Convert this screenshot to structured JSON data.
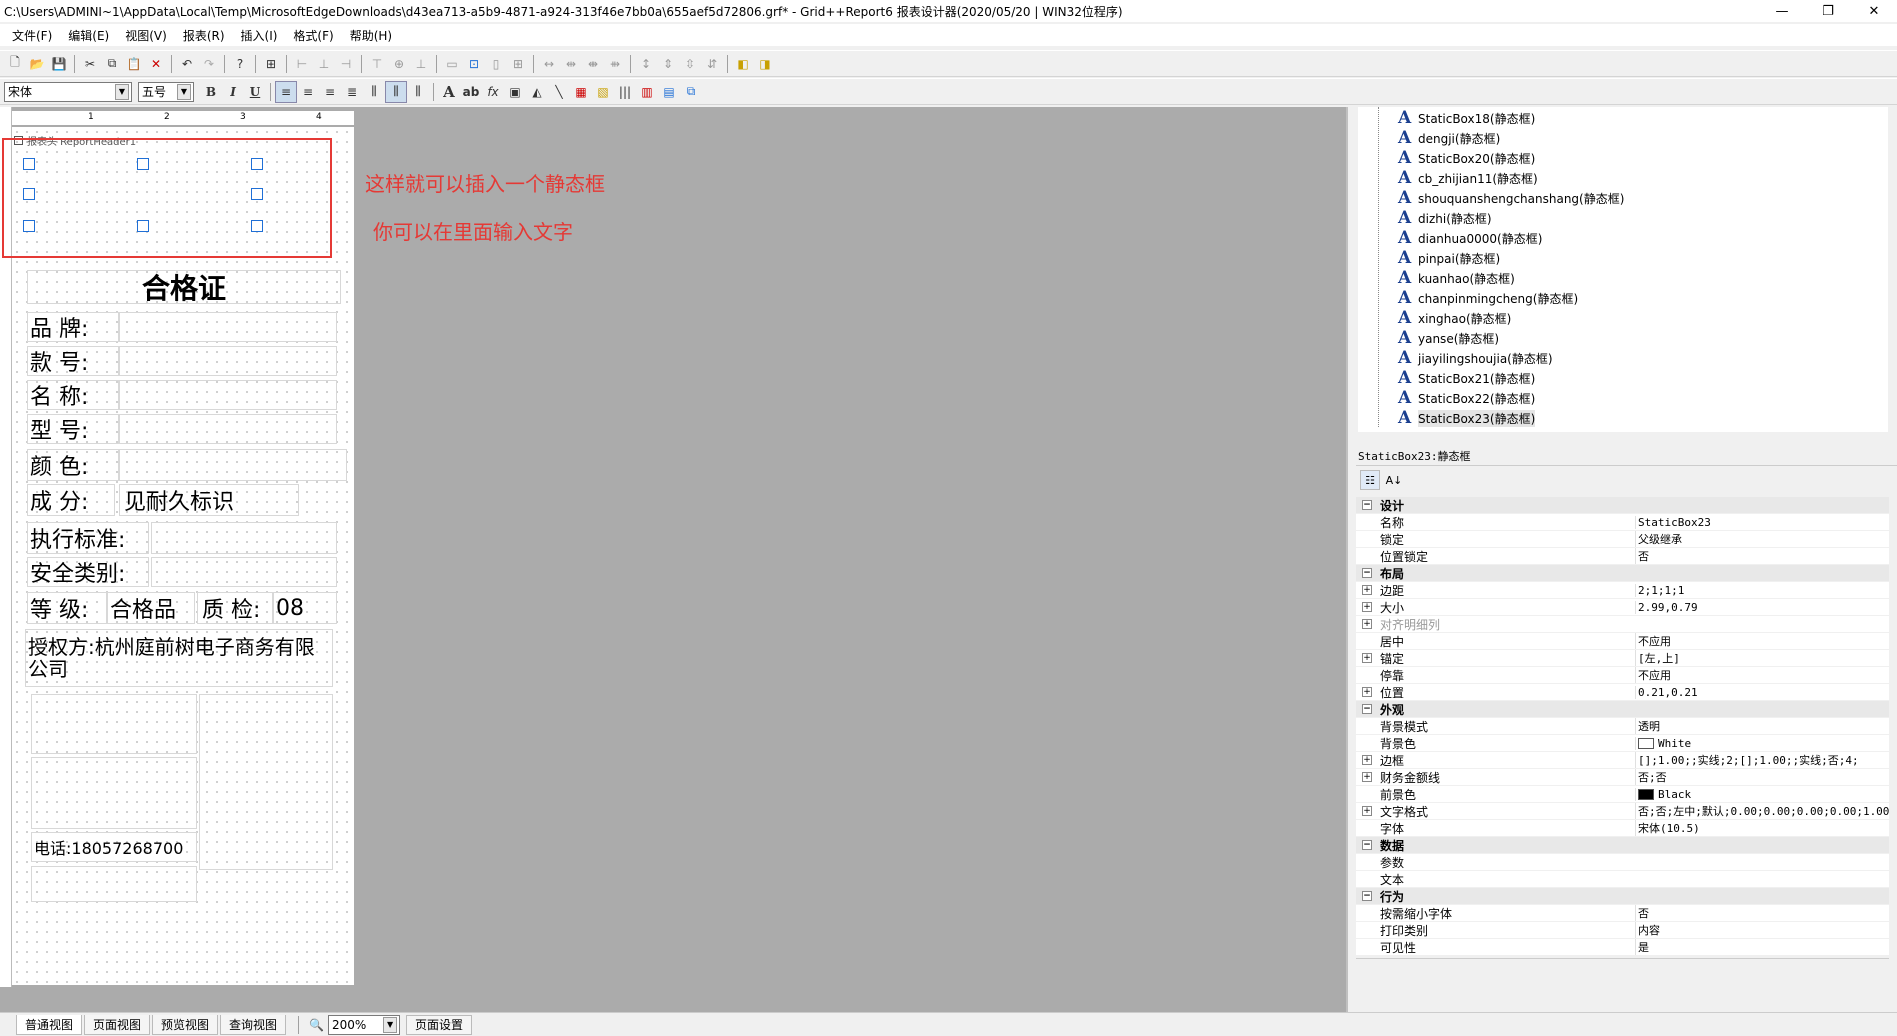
{
  "window": {
    "title": "C:\\Users\\ADMINI~1\\AppData\\Local\\Temp\\MicrosoftEdgeDownloads\\d43ea713-a5b9-4871-a924-313f46e7bb0a\\655aef5d72806.grf* - Grid++Report6 报表设计器(2020/05/20 | WIN32位程序)",
    "minimize": "—",
    "restore": "❐",
    "close": "✕"
  },
  "menu": [
    "文件(F)",
    "编辑(E)",
    "视图(V)",
    "报表(R)",
    "插入(I)",
    "格式(F)",
    "帮助(H)"
  ],
  "format_toolbar": {
    "font_name": "宋体",
    "font_size": "五号",
    "bold": "B",
    "italic": "I",
    "underline": "U"
  },
  "designer": {
    "section_label": "报表头 ReportHeader1",
    "ruler_marks": [
      "1",
      "2",
      "3",
      "4"
    ],
    "annotation_line1": "这样就可以插入一个静态框",
    "annotation_line2": "你可以在里面输入文字",
    "title": "合格证",
    "fields": {
      "brand": "品  牌:",
      "style_no": "款  号:",
      "name": "名  称:",
      "model": "型  号:",
      "color": "颜  色:",
      "composition": "成  分:",
      "composition_value": "见耐久标识",
      "standard": "执行标准:",
      "safety": "安全类别:",
      "grade": "等  级:",
      "grade_value": "合格品",
      "qc": "质  检:",
      "qc_value": "08",
      "authorizer": "授权方:杭州庭前树电子商务有限公司",
      "phone": "电话:18057268700"
    }
  },
  "tree": {
    "items": [
      "StaticBox18(静态框)",
      "dengji(静态框)",
      "StaticBox20(静态框)",
      "cb_zhijian11(静态框)",
      "shouquanshengchanshang(静态框)",
      "dizhi(静态框)",
      "dianhua0000(静态框)",
      "pinpai(静态框)",
      "kuanhao(静态框)",
      "chanpinmingcheng(静态框)",
      "xinghao(静态框)",
      "yanse(静态框)",
      "jiayilingshoujia(静态框)",
      "StaticBox21(静态框)",
      "StaticBox22(静态框)",
      "StaticBox23(静态框)"
    ],
    "selected_index": 15
  },
  "properties": {
    "title": "StaticBox23:静态框",
    "rows": [
      {
        "type": "cat",
        "name": "设计",
        "value": ""
      },
      {
        "type": "prop",
        "name": "名称",
        "value": "StaticBox23"
      },
      {
        "type": "prop",
        "name": "锁定",
        "value": "父级继承"
      },
      {
        "type": "prop",
        "name": "位置锁定",
        "value": "否"
      },
      {
        "type": "cat",
        "name": "布局",
        "value": ""
      },
      {
        "type": "exp",
        "name": "边距",
        "value": "2;1;1;1"
      },
      {
        "type": "exp",
        "name": "大小",
        "value": "2.99,0.79"
      },
      {
        "type": "dim",
        "name": "对齐明细列",
        "value": ""
      },
      {
        "type": "prop",
        "name": "居中",
        "value": "不应用"
      },
      {
        "type": "exp",
        "name": "锚定",
        "value": "[左,上]"
      },
      {
        "type": "prop",
        "name": "停靠",
        "value": "不应用"
      },
      {
        "type": "exp",
        "name": "位置",
        "value": "0.21,0.21"
      },
      {
        "type": "cat",
        "name": "外观",
        "value": ""
      },
      {
        "type": "prop",
        "name": "背景模式",
        "value": "透明"
      },
      {
        "type": "prop",
        "name": "背景色",
        "value": "White",
        "swatch": "#ffffff"
      },
      {
        "type": "exp",
        "name": "边框",
        "value": "[];1.00;;实线;2;[];1.00;;实线;否;4;"
      },
      {
        "type": "exp",
        "name": "财务金额线",
        "value": "否;否"
      },
      {
        "type": "prop",
        "name": "前景色",
        "value": "Black",
        "swatch": "#000000"
      },
      {
        "type": "exp",
        "name": "文字格式",
        "value": "否;否;左中;默认;0.00;0.00;0.00;0.00;1.00"
      },
      {
        "type": "prop",
        "name": "字体",
        "value": "宋体(10.5)"
      },
      {
        "type": "cat",
        "name": "数据",
        "value": ""
      },
      {
        "type": "prop",
        "name": "参数",
        "value": ""
      },
      {
        "type": "prop",
        "name": "文本",
        "value": ""
      },
      {
        "type": "cat",
        "name": "行为",
        "value": ""
      },
      {
        "type": "prop",
        "name": "按需缩小字体",
        "value": "否"
      },
      {
        "type": "prop",
        "name": "打印类别",
        "value": "内容"
      },
      {
        "type": "prop",
        "name": "可见性",
        "value": "是"
      }
    ]
  },
  "bottom_tabs": [
    "普通视图",
    "页面视图",
    "预览视图",
    "查询视图"
  ],
  "zoom": "200%",
  "page_setup": "页面设置",
  "colors": {
    "accent_red": "#e53935",
    "handle_blue": "#1f6fd6",
    "designer_bg": "#ababab"
  }
}
